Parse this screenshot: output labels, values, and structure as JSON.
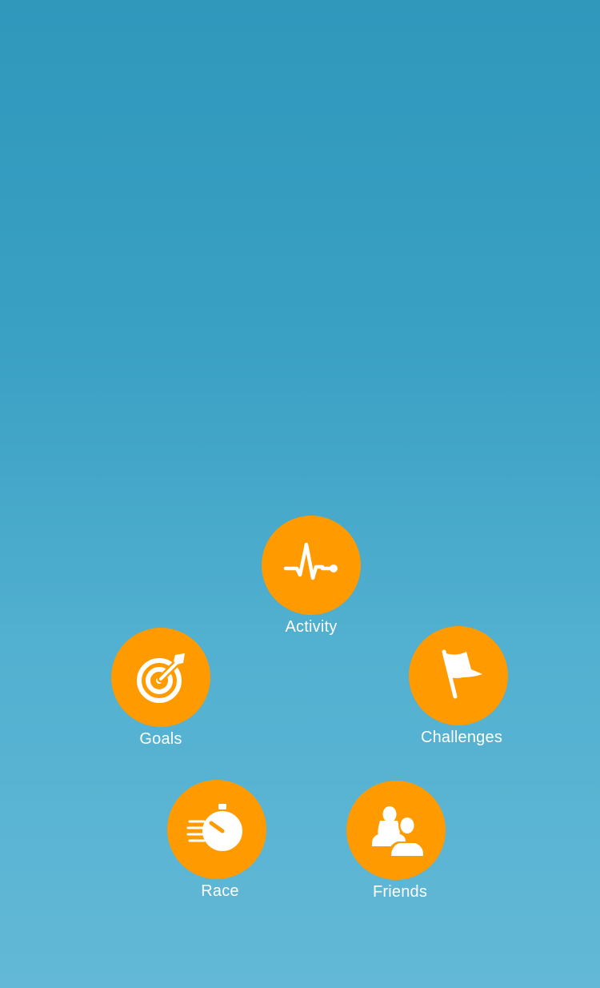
{
  "menu": {
    "activity": {
      "label": "Activity",
      "icon": "heartbeat-icon"
    },
    "goals": {
      "label": "Goals",
      "icon": "target-icon"
    },
    "challenges": {
      "label": "Challenges",
      "icon": "flag-icon"
    },
    "race": {
      "label": "Race",
      "icon": "stopwatch-icon"
    },
    "friends": {
      "label": "Friends",
      "icon": "friends-icon"
    }
  },
  "colors": {
    "background_top": "#2f98bb",
    "background_bottom": "#62b8d6",
    "button": "#ff9a00",
    "icon": "#ffffff",
    "label": "#ffffff"
  }
}
